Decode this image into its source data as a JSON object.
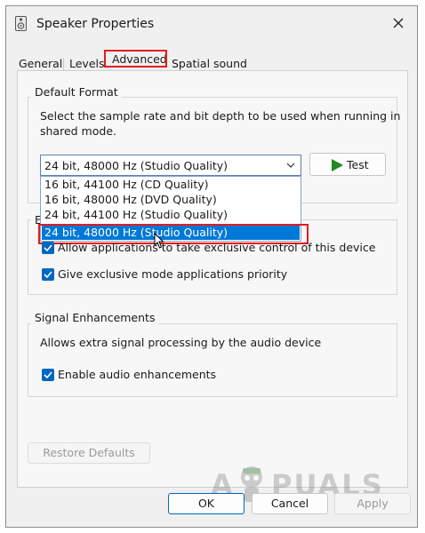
{
  "window": {
    "title": "Speaker Properties"
  },
  "tabs": [
    {
      "label": "General"
    },
    {
      "label": "Levels"
    },
    {
      "label": "Advanced"
    },
    {
      "label": "Spatial sound"
    }
  ],
  "default_format": {
    "legend": "Default Format",
    "description_line1": "Select the sample rate and bit depth to be used when running in",
    "description_line2": "shared mode.",
    "selected": "24 bit, 48000 Hz (Studio Quality)",
    "options": [
      "16 bit, 44100 Hz (CD Quality)",
      "16 bit, 48000 Hz (DVD Quality)",
      "24 bit, 44100 Hz (Studio Quality)",
      "24 bit, 48000 Hz (Studio Quality)"
    ],
    "test_label": "Test"
  },
  "exclusive": {
    "legend_partial": "E",
    "allow_label": "Allow applications to take exclusive control of this device",
    "priority_label": "Give exclusive mode applications priority"
  },
  "signal": {
    "legend": "Signal Enhancements",
    "description": "Allows extra signal processing by the audio device",
    "enable_label": "Enable audio enhancements"
  },
  "buttons": {
    "restore": "Restore Defaults",
    "ok": "OK",
    "cancel": "Cancel",
    "apply": "Apply"
  },
  "watermark": {
    "left": "A",
    "right": "PUALS"
  },
  "colors": {
    "accent": "#0067c0",
    "highlight": "#e21c1c",
    "selection": "#0078d7"
  }
}
